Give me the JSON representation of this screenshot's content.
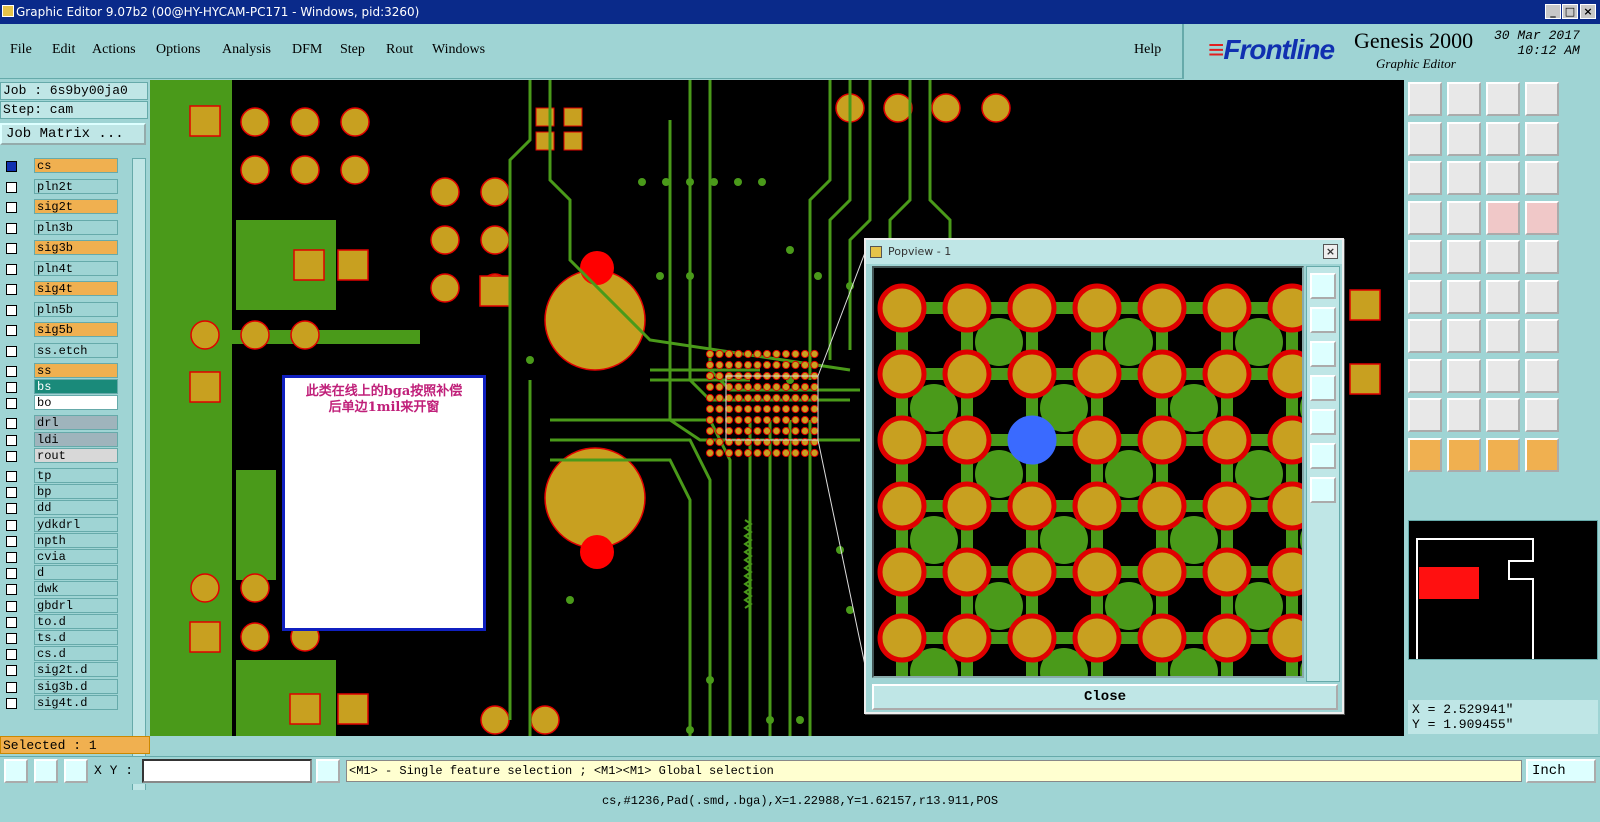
{
  "window": {
    "title": "Graphic Editor 9.07b2 (00@HY-HYCAM-PC171 - Windows, pid:3260)"
  },
  "menu": {
    "items": [
      "File",
      "Edit",
      "Actions",
      "Options",
      "Analysis",
      "DFM",
      "Step",
      "Rout",
      "Windows"
    ],
    "help": "Help"
  },
  "brand": {
    "logo": "Frontline",
    "product": "Genesis 2000",
    "subtitle": "Graphic Editor",
    "date": "30 Mar 2017",
    "time": "10:12 AM"
  },
  "job": {
    "name": "Job : 6s9by00ja0",
    "step": "Step: cam",
    "matrix_button": "Job Matrix ..."
  },
  "layers": [
    {
      "name": "cs",
      "color": "#f0b050",
      "active": true
    },
    {
      "name": "pln2t",
      "color": "#9fd4d4"
    },
    {
      "name": "sig2t",
      "color": "#f0b050"
    },
    {
      "name": "pln3b",
      "color": "#9fd4d4"
    },
    {
      "name": "sig3b",
      "color": "#f0b050"
    },
    {
      "name": "pln4t",
      "color": "#9fd4d4"
    },
    {
      "name": "sig4t",
      "color": "#f0b050"
    },
    {
      "name": "pln5b",
      "color": "#9fd4d4"
    },
    {
      "name": "sig5b",
      "color": "#f0b050"
    },
    {
      "name": "ss.etch",
      "color": "#9fd4d4"
    },
    {
      "name": "ss",
      "color": "#f0b050"
    },
    {
      "name": "bs",
      "color": "#1a8a7a"
    },
    {
      "name": "bo",
      "color": "#ffffff"
    },
    {
      "name": "drl",
      "color": "#9fb4bc"
    },
    {
      "name": "ldi",
      "color": "#9fb4bc"
    },
    {
      "name": "rout",
      "color": "#d8d8d8"
    },
    {
      "name": "tp",
      "color": "#9fd4d4"
    },
    {
      "name": "bp",
      "color": "#9fd4d4"
    },
    {
      "name": "dd",
      "color": "#9fd4d4"
    },
    {
      "name": "ydkdrl",
      "color": "#9fd4d4"
    },
    {
      "name": "npth",
      "color": "#9fd4d4"
    },
    {
      "name": "cvia",
      "color": "#9fd4d4"
    },
    {
      "name": "d",
      "color": "#9fd4d4"
    },
    {
      "name": "dwk",
      "color": "#9fd4d4"
    },
    {
      "name": "gbdrl",
      "color": "#9fd4d4"
    },
    {
      "name": "to.d",
      "color": "#9fd4d4"
    },
    {
      "name": "ts.d",
      "color": "#9fd4d4"
    },
    {
      "name": "cs.d",
      "color": "#9fd4d4"
    },
    {
      "name": "sig2t.d",
      "color": "#9fd4d4"
    },
    {
      "name": "sig3b.d",
      "color": "#9fd4d4"
    },
    {
      "name": "sig4t.d",
      "color": "#9fd4d4"
    }
  ],
  "note": {
    "line1": "此类在线上的bga按照补偿",
    "line2": "后单边1mil来开窗"
  },
  "popview": {
    "title": "Popview - 1",
    "close_label": "Close"
  },
  "coords": {
    "x": "X =  2.529941\"",
    "y": "Y =  1.909455\""
  },
  "selected": "Selected : 1",
  "bottom": {
    "xy_label": "X Y :",
    "xy_value": "",
    "hint": "<M1> - Single feature selection ; <M1><M1> Global selection",
    "unit": "Inch"
  },
  "status": "cs,#1236,Pad(.smd,.bga),X=1.22988,Y=1.62157,r13.911,POS",
  "colors": {
    "pad": "#c8a020",
    "pad_outline": "#e00000",
    "copper": "#4a9a1a",
    "board": "#000000",
    "highlight": "#3a6aff"
  }
}
